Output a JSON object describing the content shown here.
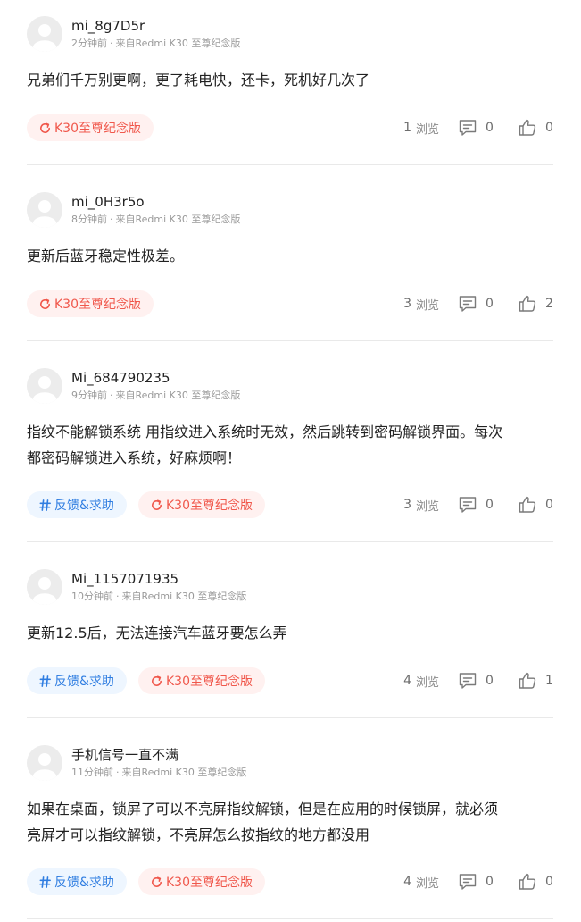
{
  "labels": {
    "views": "浏览"
  },
  "colors": {
    "device_tag": "#f0584c",
    "topic_tag": "#2f7de1",
    "divider": "#e9e9e9"
  },
  "icons": {
    "device_tag": "refresh-icon",
    "topic_tag": "hash-icon",
    "comment": "comment-icon",
    "like": "thumbs-up-icon"
  },
  "posts": [
    {
      "username": "mi_8g7D5r",
      "time": "2分钟前",
      "source": "来自Redmi K30 至尊纪念版",
      "content_lines": [
        "兄弟们千万别更啊，更了耗电快，还卡，死机好几次了"
      ],
      "topic_tag": null,
      "device_tag": "K30至尊纪念版",
      "views": "1",
      "comments": "0",
      "likes": "0"
    },
    {
      "username": "mi_0H3r5o",
      "time": "8分钟前",
      "source": "来自Redmi K30 至尊纪念版",
      "content_lines": [
        "更新后蓝牙稳定性极差。"
      ],
      "topic_tag": null,
      "device_tag": "K30至尊纪念版",
      "views": "3",
      "comments": "0",
      "likes": "2"
    },
    {
      "username": "Mi_684790235",
      "time": "9分钟前",
      "source": "来自Redmi K30 至尊纪念版",
      "content_lines": [
        "指纹不能解锁系统 用指纹进入系统时无效，然后跳转到密码解锁界面。每次",
        "都密码解锁进入系统，好麻烦啊！"
      ],
      "topic_tag": "反馈&求助",
      "device_tag": "K30至尊纪念版",
      "views": "3",
      "comments": "0",
      "likes": "0"
    },
    {
      "username": "Mi_1157071935",
      "time": "10分钟前",
      "source": "来自Redmi K30 至尊纪念版",
      "content_lines": [
        "更新12.5后，无法连接汽车蓝牙要怎么弄"
      ],
      "topic_tag": "反馈&求助",
      "device_tag": "K30至尊纪念版",
      "views": "4",
      "comments": "0",
      "likes": "1"
    },
    {
      "username": "手机信号一直不满",
      "time": "11分钟前",
      "source": "来自Redmi K30 至尊纪念版",
      "content_lines": [
        "如果在桌面，锁屏了可以不亮屏指纹解锁，但是在应用的时候锁屏，就必须",
        "亮屏才可以指纹解锁，不亮屏怎么按指纹的地方都没用"
      ],
      "topic_tag": "反馈&求助",
      "device_tag": "K30至尊纪念版",
      "views": "4",
      "comments": "0",
      "likes": "0"
    }
  ]
}
